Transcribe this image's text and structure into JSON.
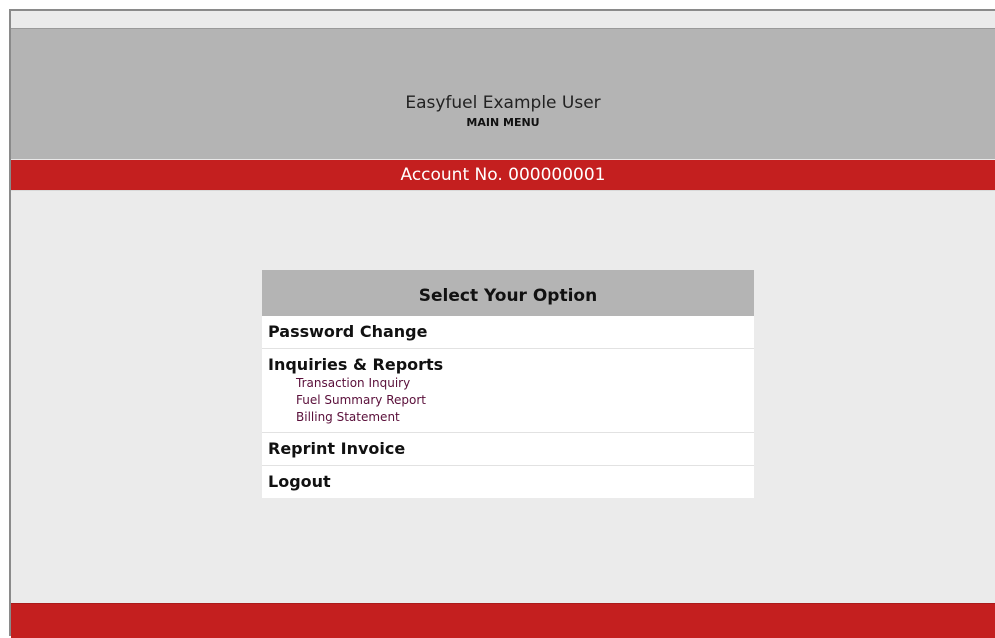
{
  "header": {
    "user_name": "Easyfuel Example User",
    "menu_title": "MAIN MENU"
  },
  "account": {
    "label": "Account No. 000000001"
  },
  "options": {
    "title": "Select Your Option",
    "password_change": "Password Change",
    "inquiries": {
      "label": "Inquiries & Reports",
      "items": [
        {
          "label": "Transaction Inquiry"
        },
        {
          "label": "Fuel Summary Report"
        },
        {
          "label": "Billing Statement"
        }
      ]
    },
    "reprint_invoice": "Reprint Invoice",
    "logout": "Logout"
  },
  "colors": {
    "header_gray": "#b4b4b4",
    "accent_red": "#c41f1f",
    "background": "#ebebeb",
    "sub_link": "#5a0f3a"
  }
}
